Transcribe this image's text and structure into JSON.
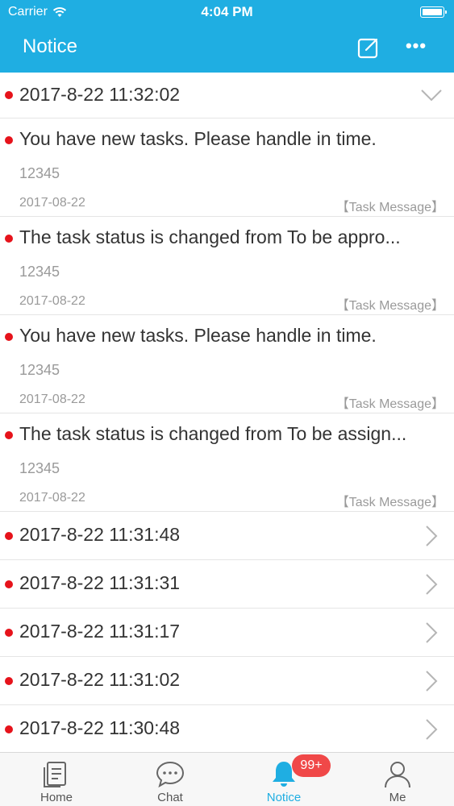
{
  "status_bar": {
    "carrier": "Carrier",
    "time": "4:04 PM"
  },
  "navbar": {
    "title": "Notice"
  },
  "groups": [
    {
      "datetime": "2017-8-22 11:32:02",
      "expanded": true,
      "messages": [
        {
          "title": "You have new tasks. Please handle in time.",
          "body": "12345",
          "date": "2017-08-22",
          "tag": "【Task Message】"
        },
        {
          "title": "The task status is changed from To be appro...",
          "body": "12345",
          "date": "2017-08-22",
          "tag": "【Task Message】"
        },
        {
          "title": "You have new tasks. Please handle in time.",
          "body": "12345",
          "date": "2017-08-22",
          "tag": "【Task Message】"
        },
        {
          "title": "The task status is changed from To be assign...",
          "body": "12345",
          "date": "2017-08-22",
          "tag": "【Task Message】"
        }
      ]
    }
  ],
  "collapsed_items": [
    "2017-8-22 11:31:48",
    "2017-8-22 11:31:31",
    "2017-8-22 11:31:17",
    "2017-8-22 11:31:02",
    "2017-8-22 11:30:48"
  ],
  "tabbar": {
    "tabs": [
      {
        "label": "Home",
        "icon": "document-icon"
      },
      {
        "label": "Chat",
        "icon": "chat-bubble-icon"
      },
      {
        "label": "Notice",
        "icon": "bell-icon",
        "active": true
      },
      {
        "label": "Me",
        "icon": "person-icon"
      }
    ],
    "notice_badge": "99+"
  },
  "colors": {
    "brand": "#1FAEE2",
    "unread_dot": "#E6131B",
    "badge": "#F04848"
  }
}
